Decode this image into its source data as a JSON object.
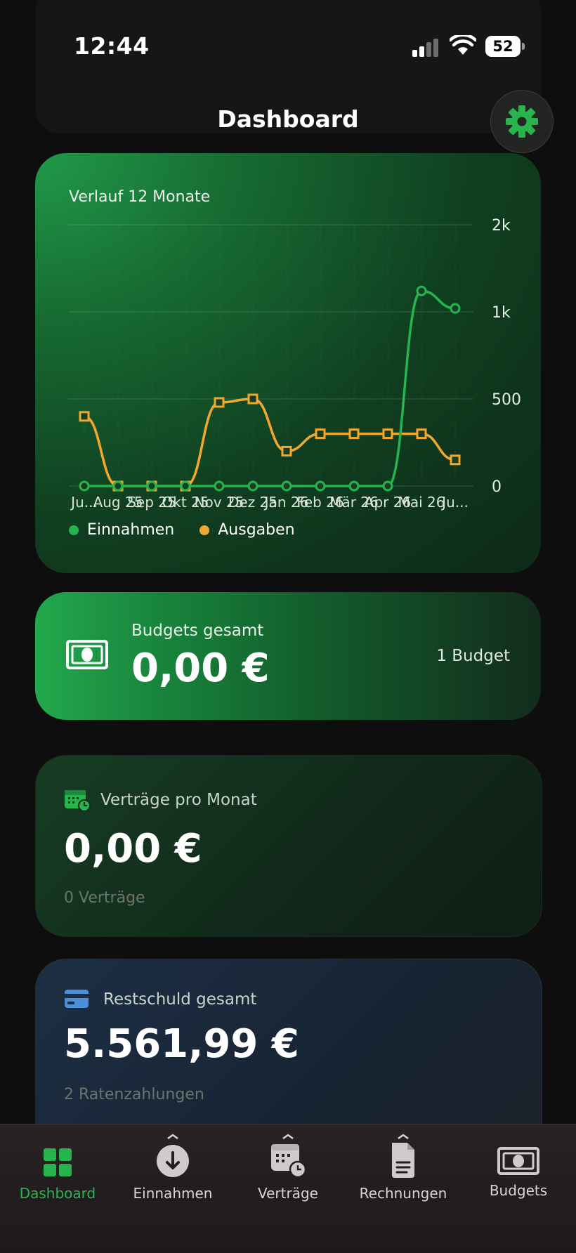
{
  "status_bar": {
    "time": "12:44",
    "battery": "52"
  },
  "header": {
    "title": "Dashboard"
  },
  "chart_card": {
    "title": "Verlauf 12 Monate",
    "legend": [
      {
        "label": "Einnahmen",
        "color": "#27b44e"
      },
      {
        "label": "Ausgaben",
        "color": "#f2a82f"
      }
    ]
  },
  "chart_data": {
    "type": "line",
    "title": "Verlauf 12 Monate",
    "categories": [
      "Ju...",
      "Aug 25",
      "Sep 25",
      "Okt 25",
      "Nov 25",
      "Dez 25",
      "Jan 26",
      "Feb 26",
      "Mär 26",
      "Apr 26",
      "Mai 26",
      "Ju..."
    ],
    "y_ticks": [
      "0",
      "500",
      "1k",
      "2k"
    ],
    "y_axis_side": "right",
    "grid": true,
    "legend_position": "bottom-left",
    "series": [
      {
        "name": "Einnahmen",
        "color": "#27b44e",
        "marker": "circle",
        "values": [
          0,
          0,
          0,
          0,
          0,
          0,
          0,
          0,
          0,
          0,
          1240,
          1040
        ]
      },
      {
        "name": "Ausgaben",
        "color": "#f2a82f",
        "marker": "square",
        "values": [
          400,
          0,
          0,
          0,
          480,
          500,
          200,
          300,
          300,
          300,
          300,
          150
        ]
      }
    ]
  },
  "budget_card": {
    "label": "Budgets gesamt",
    "value": "0,00 €",
    "count": "1 Budget"
  },
  "vertraege_card": {
    "label": "Verträge pro Monat",
    "value": "0,00 €",
    "sub": "0 Verträge"
  },
  "rest_card": {
    "label": "Restschuld gesamt",
    "value": "5.561,99 €",
    "sub": "2 Ratenzahlungen"
  },
  "tabbar": {
    "items": [
      {
        "label": "Dashboard",
        "icon": "grid-icon",
        "active": true
      },
      {
        "label": "Einnahmen",
        "icon": "income-icon",
        "active": false
      },
      {
        "label": "Verträge",
        "icon": "contracts-calendar-icon",
        "active": false
      },
      {
        "label": "Rechnungen",
        "icon": "invoice-icon",
        "active": false
      },
      {
        "label": "Budgets",
        "icon": "banknote-icon",
        "active": false
      }
    ]
  },
  "colors": {
    "accent": "#27b44e",
    "expense": "#f2a82f",
    "debt_icon": "#4a90d9"
  }
}
